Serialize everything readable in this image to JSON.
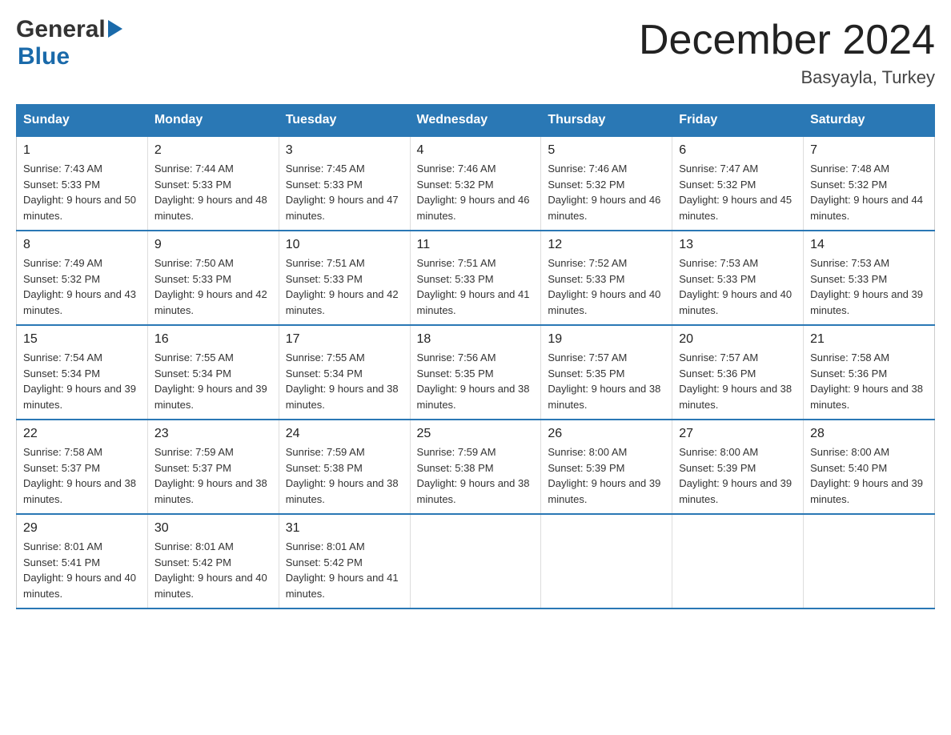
{
  "header": {
    "logo_general": "General",
    "logo_blue": "Blue",
    "month_title": "December 2024",
    "location": "Basyayla, Turkey"
  },
  "days_of_week": [
    "Sunday",
    "Monday",
    "Tuesday",
    "Wednesday",
    "Thursday",
    "Friday",
    "Saturday"
  ],
  "weeks": [
    [
      {
        "day": "1",
        "sunrise": "7:43 AM",
        "sunset": "5:33 PM",
        "daylight": "9 hours and 50 minutes."
      },
      {
        "day": "2",
        "sunrise": "7:44 AM",
        "sunset": "5:33 PM",
        "daylight": "9 hours and 48 minutes."
      },
      {
        "day": "3",
        "sunrise": "7:45 AM",
        "sunset": "5:33 PM",
        "daylight": "9 hours and 47 minutes."
      },
      {
        "day": "4",
        "sunrise": "7:46 AM",
        "sunset": "5:32 PM",
        "daylight": "9 hours and 46 minutes."
      },
      {
        "day": "5",
        "sunrise": "7:46 AM",
        "sunset": "5:32 PM",
        "daylight": "9 hours and 46 minutes."
      },
      {
        "day": "6",
        "sunrise": "7:47 AM",
        "sunset": "5:32 PM",
        "daylight": "9 hours and 45 minutes."
      },
      {
        "day": "7",
        "sunrise": "7:48 AM",
        "sunset": "5:32 PM",
        "daylight": "9 hours and 44 minutes."
      }
    ],
    [
      {
        "day": "8",
        "sunrise": "7:49 AM",
        "sunset": "5:32 PM",
        "daylight": "9 hours and 43 minutes."
      },
      {
        "day": "9",
        "sunrise": "7:50 AM",
        "sunset": "5:33 PM",
        "daylight": "9 hours and 42 minutes."
      },
      {
        "day": "10",
        "sunrise": "7:51 AM",
        "sunset": "5:33 PM",
        "daylight": "9 hours and 42 minutes."
      },
      {
        "day": "11",
        "sunrise": "7:51 AM",
        "sunset": "5:33 PM",
        "daylight": "9 hours and 41 minutes."
      },
      {
        "day": "12",
        "sunrise": "7:52 AM",
        "sunset": "5:33 PM",
        "daylight": "9 hours and 40 minutes."
      },
      {
        "day": "13",
        "sunrise": "7:53 AM",
        "sunset": "5:33 PM",
        "daylight": "9 hours and 40 minutes."
      },
      {
        "day": "14",
        "sunrise": "7:53 AM",
        "sunset": "5:33 PM",
        "daylight": "9 hours and 39 minutes."
      }
    ],
    [
      {
        "day": "15",
        "sunrise": "7:54 AM",
        "sunset": "5:34 PM",
        "daylight": "9 hours and 39 minutes."
      },
      {
        "day": "16",
        "sunrise": "7:55 AM",
        "sunset": "5:34 PM",
        "daylight": "9 hours and 39 minutes."
      },
      {
        "day": "17",
        "sunrise": "7:55 AM",
        "sunset": "5:34 PM",
        "daylight": "9 hours and 38 minutes."
      },
      {
        "day": "18",
        "sunrise": "7:56 AM",
        "sunset": "5:35 PM",
        "daylight": "9 hours and 38 minutes."
      },
      {
        "day": "19",
        "sunrise": "7:57 AM",
        "sunset": "5:35 PM",
        "daylight": "9 hours and 38 minutes."
      },
      {
        "day": "20",
        "sunrise": "7:57 AM",
        "sunset": "5:36 PM",
        "daylight": "9 hours and 38 minutes."
      },
      {
        "day": "21",
        "sunrise": "7:58 AM",
        "sunset": "5:36 PM",
        "daylight": "9 hours and 38 minutes."
      }
    ],
    [
      {
        "day": "22",
        "sunrise": "7:58 AM",
        "sunset": "5:37 PM",
        "daylight": "9 hours and 38 minutes."
      },
      {
        "day": "23",
        "sunrise": "7:59 AM",
        "sunset": "5:37 PM",
        "daylight": "9 hours and 38 minutes."
      },
      {
        "day": "24",
        "sunrise": "7:59 AM",
        "sunset": "5:38 PM",
        "daylight": "9 hours and 38 minutes."
      },
      {
        "day": "25",
        "sunrise": "7:59 AM",
        "sunset": "5:38 PM",
        "daylight": "9 hours and 38 minutes."
      },
      {
        "day": "26",
        "sunrise": "8:00 AM",
        "sunset": "5:39 PM",
        "daylight": "9 hours and 39 minutes."
      },
      {
        "day": "27",
        "sunrise": "8:00 AM",
        "sunset": "5:39 PM",
        "daylight": "9 hours and 39 minutes."
      },
      {
        "day": "28",
        "sunrise": "8:00 AM",
        "sunset": "5:40 PM",
        "daylight": "9 hours and 39 minutes."
      }
    ],
    [
      {
        "day": "29",
        "sunrise": "8:01 AM",
        "sunset": "5:41 PM",
        "daylight": "9 hours and 40 minutes."
      },
      {
        "day": "30",
        "sunrise": "8:01 AM",
        "sunset": "5:42 PM",
        "daylight": "9 hours and 40 minutes."
      },
      {
        "day": "31",
        "sunrise": "8:01 AM",
        "sunset": "5:42 PM",
        "daylight": "9 hours and 41 minutes."
      },
      null,
      null,
      null,
      null
    ]
  ],
  "labels": {
    "sunrise": "Sunrise: ",
    "sunset": "Sunset: ",
    "daylight": "Daylight: "
  }
}
